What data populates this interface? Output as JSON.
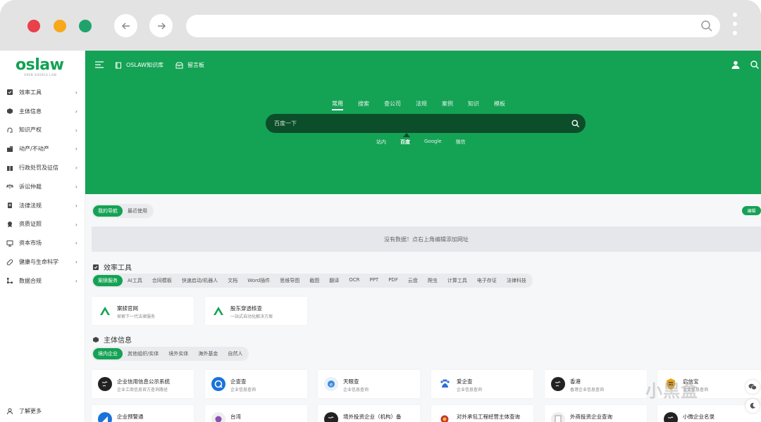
{
  "browser": {
    "url_value": ""
  },
  "sidebar": {
    "logo_text": "oslaw",
    "logo_sub": "OPEN SOURCE LAW",
    "items": [
      {
        "label": "效率工具"
      },
      {
        "label": "主体信息"
      },
      {
        "label": "知识产权"
      },
      {
        "label": "动产/不动产"
      },
      {
        "label": "行政处罚及征信"
      },
      {
        "label": "诉讼仲裁"
      },
      {
        "label": "法律法规"
      },
      {
        "label": "资质证照"
      },
      {
        "label": "资本市场"
      },
      {
        "label": "健康与生命科学"
      },
      {
        "label": "数据合规"
      }
    ],
    "footer": "了解更多"
  },
  "topnav": {
    "knowledge_base": "OSLAW知识库",
    "message_board": "留言板"
  },
  "search": {
    "tabs": [
      "常用",
      "搜索",
      "查公司",
      "法规",
      "案例",
      "知识",
      "模板"
    ],
    "active_tab": 0,
    "placeholder": "百度一下",
    "value": "",
    "engines": [
      "站内",
      "百度",
      "Google",
      "微信"
    ],
    "active_engine": 1
  },
  "my_nav": {
    "tabs": [
      "我的导航",
      "最近使用"
    ],
    "edit_label": "编辑",
    "empty_text": "没有数据！点右上角编辑添加网址"
  },
  "efficiency": {
    "title": "效率工具",
    "tabs": [
      "案牍服务",
      "AI工具",
      "合同模板",
      "快速启动/机器人",
      "文档",
      "Word插件",
      "思维导图",
      "截图",
      "翻译",
      "OCR",
      "PPT",
      "PDF",
      "云盘",
      "爬虫",
      "计算工具",
      "电子存证",
      "法律科技"
    ],
    "cards": [
      {
        "title": "案牍官网",
        "desc": "探索下一代法律服务"
      },
      {
        "title": "股东穿透核查",
        "desc": "一站式自动化解决方案"
      }
    ]
  },
  "entity": {
    "title": "主体信息",
    "tabs": [
      "境内企业",
      "其他组织/实体",
      "境外实体",
      "海外基金",
      "自然人"
    ],
    "cards": [
      {
        "title": "企业信用信息公示系统",
        "desc": "企业工商信息官方查询路径"
      },
      {
        "title": "企查查",
        "desc": "企业信息查询"
      },
      {
        "title": "天眼查",
        "desc": "企业信息查询"
      },
      {
        "title": "爱企查",
        "desc": "企业信息查询"
      },
      {
        "title": "香港",
        "desc": "香港企业信息查询"
      },
      {
        "title": "启信宝",
        "desc": "企业信息查询"
      }
    ],
    "cards_row2": [
      {
        "title": "企业预警通"
      },
      {
        "title": "台湾"
      },
      {
        "title": "境外投资企业（机构）备"
      },
      {
        "title": "对外承包工程经营主体查询"
      },
      {
        "title": "外商投资企业查询"
      },
      {
        "title": "小微企业名录"
      }
    ]
  },
  "watermark": "小黑盒",
  "colors": {
    "brand_green": "#14a254",
    "search_dark": "#0c4d2a"
  }
}
